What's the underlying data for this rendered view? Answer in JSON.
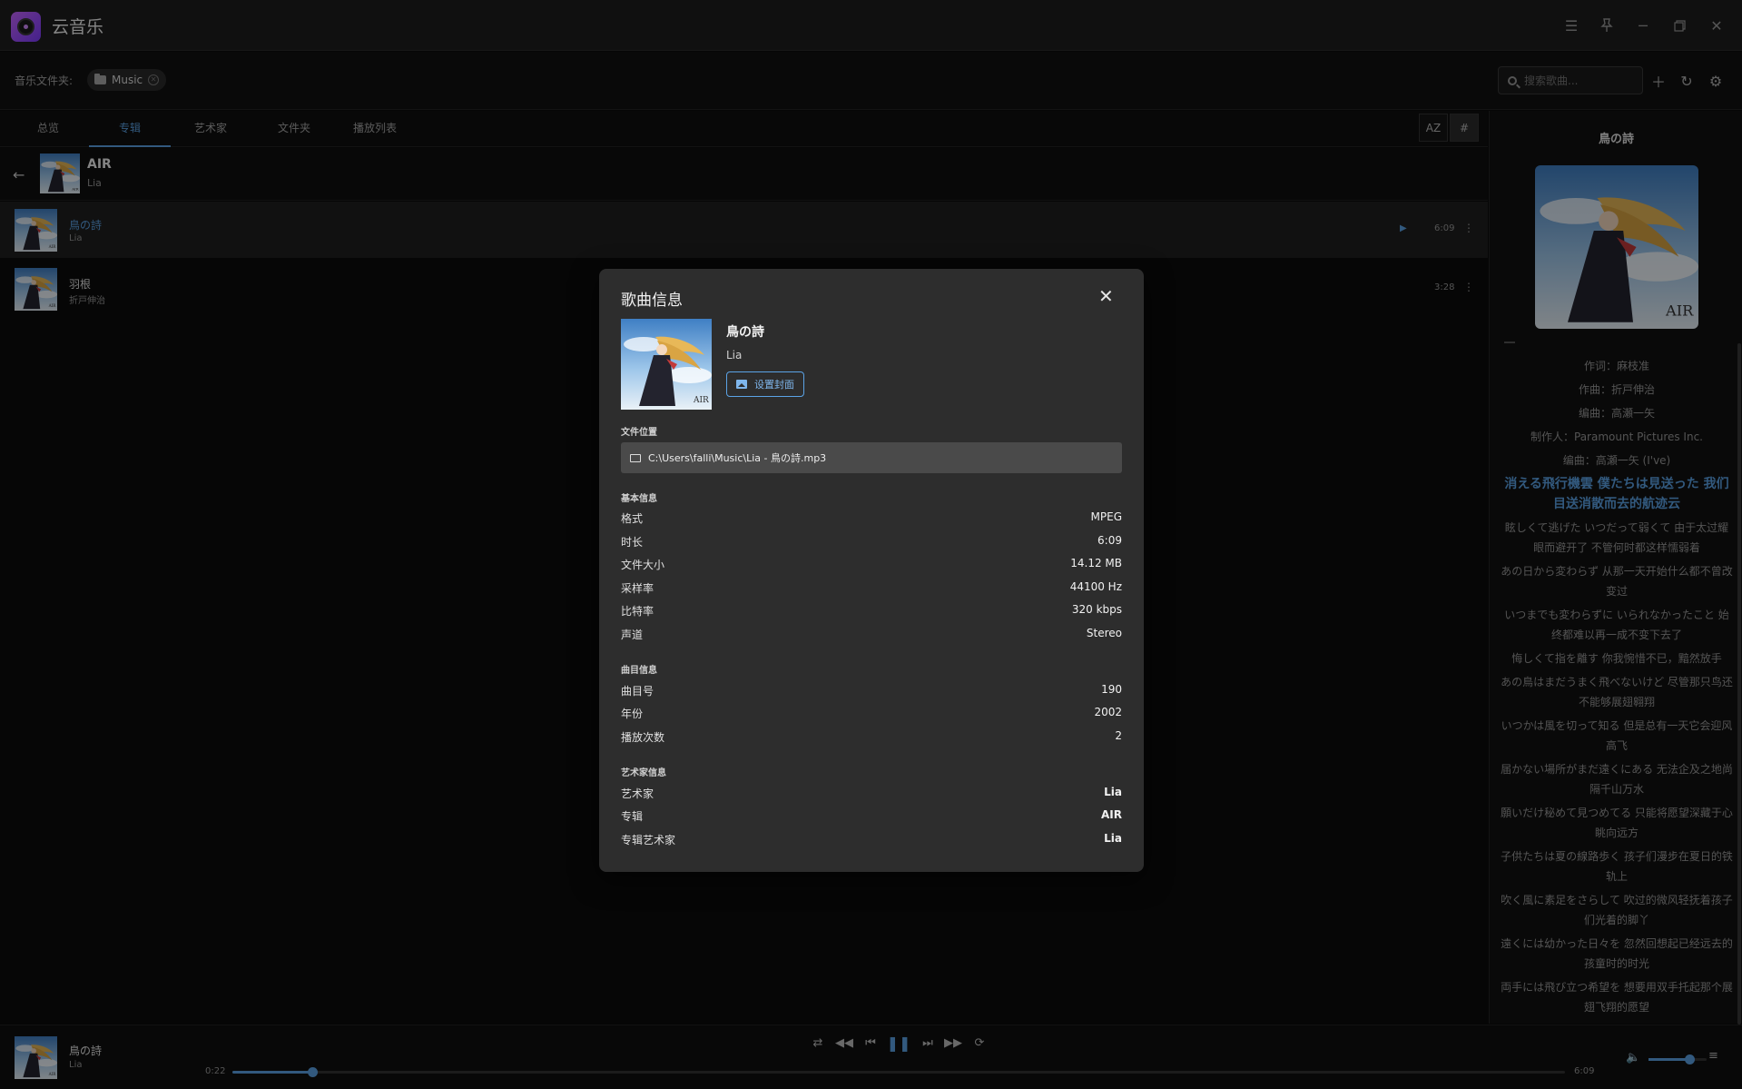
{
  "app": {
    "title": "云音乐"
  },
  "folderbar": {
    "label": "音乐文件夹:",
    "folder": "Music",
    "search_placeholder": "搜索歌曲..."
  },
  "tabs": [
    "总览",
    "专辑",
    "艺术家",
    "文件夹",
    "播放列表"
  ],
  "active_tab": 1,
  "sort": {
    "az": "AZ",
    "num": "#"
  },
  "album": {
    "name": "AIR",
    "artist": "Lia"
  },
  "tracks": [
    {
      "title": "鳥の詩",
      "artist": "Lia",
      "duration": "6:09",
      "selected": true
    },
    {
      "title": "羽根",
      "artist": "折戸伸治",
      "duration": "3:28",
      "selected": false
    }
  ],
  "right_panel": {
    "title": "鳥の詩",
    "lyrics": [
      "作词：麻枝准",
      "作曲：折戸伸治",
      "编曲：高瀬一矢",
      "制作人：Paramount Pictures Inc.",
      "编曲：高瀬一矢 (I've)",
      "消える飛行機雲 僕たちは見送った 我们目送消散而去的航迹云",
      "眩しくて逃げた いつだって弱くて 由于太过耀眼而避开了 不管何时都这样懦弱着",
      "あの日から変わらず 从那一天开始什么都不曾改变过",
      "いつまでも変わらずに いられなかったこと 始终都难以再一成不变下去了",
      "悔しくて指を離す 你我惋惜不已，黯然放手",
      "あの鳥はまだうまく飛べないけど 尽管那只鸟还不能够展翅翱翔",
      "いつかは風を切って知る 但是总有一天它会迎风高飞",
      "届かない場所がまだ遠くにある 无法企及之地尚隔千山万水",
      "願いだけ秘めて見つめてる 只能将愿望深藏于心 眺向远方",
      "子供たちは夏の線路歩く 孩子们漫步在夏日的铁轨上",
      "吹く風に素足をさらして 吹过的微风轻抚着孩子们光着的脚丫",
      "遠くには幼かった日々を 忽然回想起已经远去的孩童时的时光",
      "両手には飛び立つ希望を 想要用双手托起那个展翅飞翔的愿望"
    ],
    "current_index": 5
  },
  "player": {
    "title": "鳥の詩",
    "artist": "Lia",
    "current": "0:22",
    "total": "6:09",
    "progress": 0.06,
    "volume": 0.7
  },
  "modal": {
    "title": "歌曲信息",
    "song": "鳥の詩",
    "artist": "Lia",
    "set_cover": "设置封面",
    "file_section": "文件位置",
    "path": "C:\\Users\\falli\\Music\\Lia - 鳥の詩.mp3",
    "basic_section": "基本信息",
    "basic": [
      {
        "k": "格式",
        "v": "MPEG"
      },
      {
        "k": "时长",
        "v": "6:09"
      },
      {
        "k": "文件大小",
        "v": "14.12 MB"
      },
      {
        "k": "采样率",
        "v": "44100 Hz"
      },
      {
        "k": "比特率",
        "v": "320 kbps"
      },
      {
        "k": "声道",
        "v": "Stereo"
      }
    ],
    "track_section": "曲目信息",
    "track": [
      {
        "k": "曲目号",
        "v": "190"
      },
      {
        "k": "年份",
        "v": "2002"
      },
      {
        "k": "播放次数",
        "v": "2"
      }
    ],
    "artist_section": "艺术家信息",
    "artist_info": [
      {
        "k": "艺术家",
        "v": "Lia"
      },
      {
        "k": "专辑",
        "v": "AIR"
      },
      {
        "k": "专辑艺术家",
        "v": "Lia"
      }
    ]
  },
  "colors": {
    "accent": "#5ba3e6",
    "modal_bg": "#2d2d2d",
    "bg": "#0b0b0b"
  }
}
